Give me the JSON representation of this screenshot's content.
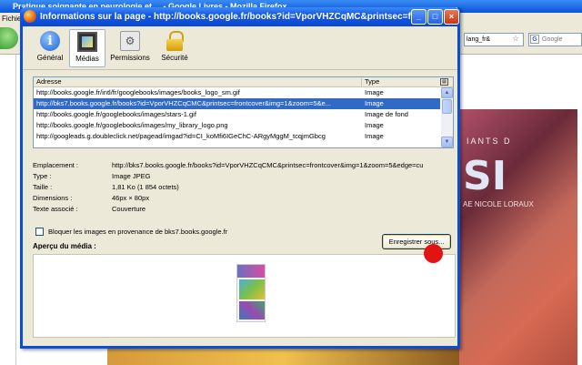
{
  "background_browser": {
    "title": "Pratique soignante en neurologie et ... - Google Livres - Mozilla Firefox",
    "menu_fragment": "Fichie",
    "url_fragment": "lang_fr&",
    "search_placeholder": "Google",
    "search_engine_letter": "G",
    "book_cover_title": "IANTS D",
    "book_cover_big": "SI",
    "book_cover_author": "AE NICOLE LORAUX"
  },
  "dialog": {
    "title": "Informations sur la page - http://books.google.fr/books?id=VporVHZCqMC&printsec=f...",
    "toolbar": {
      "general": "Général",
      "medias": "Médias",
      "permissions": "Permissions",
      "securite": "Sécurité"
    },
    "list": {
      "columns": [
        "Adresse",
        "Type"
      ],
      "rows": [
        {
          "address": "http://books.google.fr/intl/fr/googlebooks/images/books_logo_sm.gif",
          "type": "Image"
        },
        {
          "address": "http://bks7.books.google.fr/books?id=VporVHZCqCMC&printsec=frontcover&img=1&zoom=5&e...",
          "type": "Image",
          "selected": true
        },
        {
          "address": "http://books.google.fr/googlebooks/images/stars-1.gif",
          "type": "Image de fond"
        },
        {
          "address": "http://books.google.fr/googlebooks/images/my_library_logo.png",
          "type": "Image"
        },
        {
          "address": "http://googleads.g.doubleclick.net/pagead/imgad?id=CI_koMfi6IGeChC-ARgyMggM_tcqjmGbcg",
          "type": "Image"
        }
      ]
    },
    "details": [
      {
        "label": "Emplacement :",
        "value": "http://bks7.books.google.fr/books?id=VporVHZCqCMC&printsec=frontcover&img=1&zoom=5&edge=cu"
      },
      {
        "label": "Type :",
        "value": "Image JPEG"
      },
      {
        "label": "Taille :",
        "value": "1,81 Ko (1 854 octets)"
      },
      {
        "label": "Dimensions :",
        "value": "46px × 80px"
      },
      {
        "label": "Texte associé :",
        "value": "Couverture"
      }
    ],
    "block_images_label": "Bloquer les images en provenance de bks7.books.google.fr",
    "block_images_checked": false,
    "preview_label": "Aperçu du média :",
    "save_button": "Enregistrer sous..."
  },
  "colors": {
    "titlebar": "#0a48d2",
    "selection": "#316ac5",
    "click_marker": "#e21313"
  }
}
